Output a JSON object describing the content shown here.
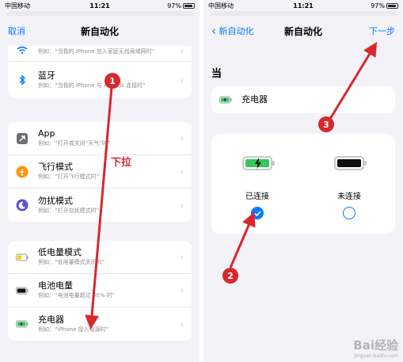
{
  "status": {
    "carrier": "中国移动",
    "time": "11:21",
    "battery": "97%"
  },
  "left": {
    "nav": {
      "cancel": "取消",
      "title": "新自动化"
    },
    "group1": [
      {
        "icon": "wifi-icon",
        "title": "",
        "example": "例如：“当我的 iPhone 加入家庭无线局域网时”"
      },
      {
        "icon": "bluetooth-icon",
        "title": "蓝牙",
        "example": "例如：“当我的 iPhone 与 AirPods 连接时”"
      }
    ],
    "group2": [
      {
        "icon": "app-icon",
        "title": "App",
        "example": "例如：“打开或关闭“天气”时”"
      },
      {
        "icon": "airplane-icon",
        "title": "飞行模式",
        "example": "例如：“打开飞行模式时”"
      },
      {
        "icon": "moon-icon",
        "title": "勿扰模式",
        "example": "例如：“打开勿扰模式时”"
      }
    ],
    "group3": [
      {
        "icon": "low-power-battery-icon",
        "title": "低电量模式",
        "example": "例如：“低电量模式关闭时”"
      },
      {
        "icon": "battery-level-icon",
        "title": "电池电量",
        "example": "例如：“电池电量超过 50% 时”"
      },
      {
        "icon": "charger-icon",
        "title": "充电器",
        "example": "例如：“iPhone 接入电源时”"
      }
    ]
  },
  "right": {
    "nav": {
      "back": "新自动化",
      "title": "新自动化",
      "next": "下一步"
    },
    "section": "当",
    "trigger": "充电器",
    "options": [
      {
        "label": "已连接",
        "selected": true
      },
      {
        "label": "未连接",
        "selected": false
      }
    ]
  },
  "annotations": {
    "step1": "1",
    "step2": "2",
    "step3": "3",
    "pull_label": "下拉"
  },
  "watermark": {
    "brand": "Bai经验",
    "url": "jingyan.baidu.com"
  },
  "colors": {
    "accent": "#0a7aff",
    "annotation": "#d9272e",
    "battery_green": "#34c759"
  }
}
